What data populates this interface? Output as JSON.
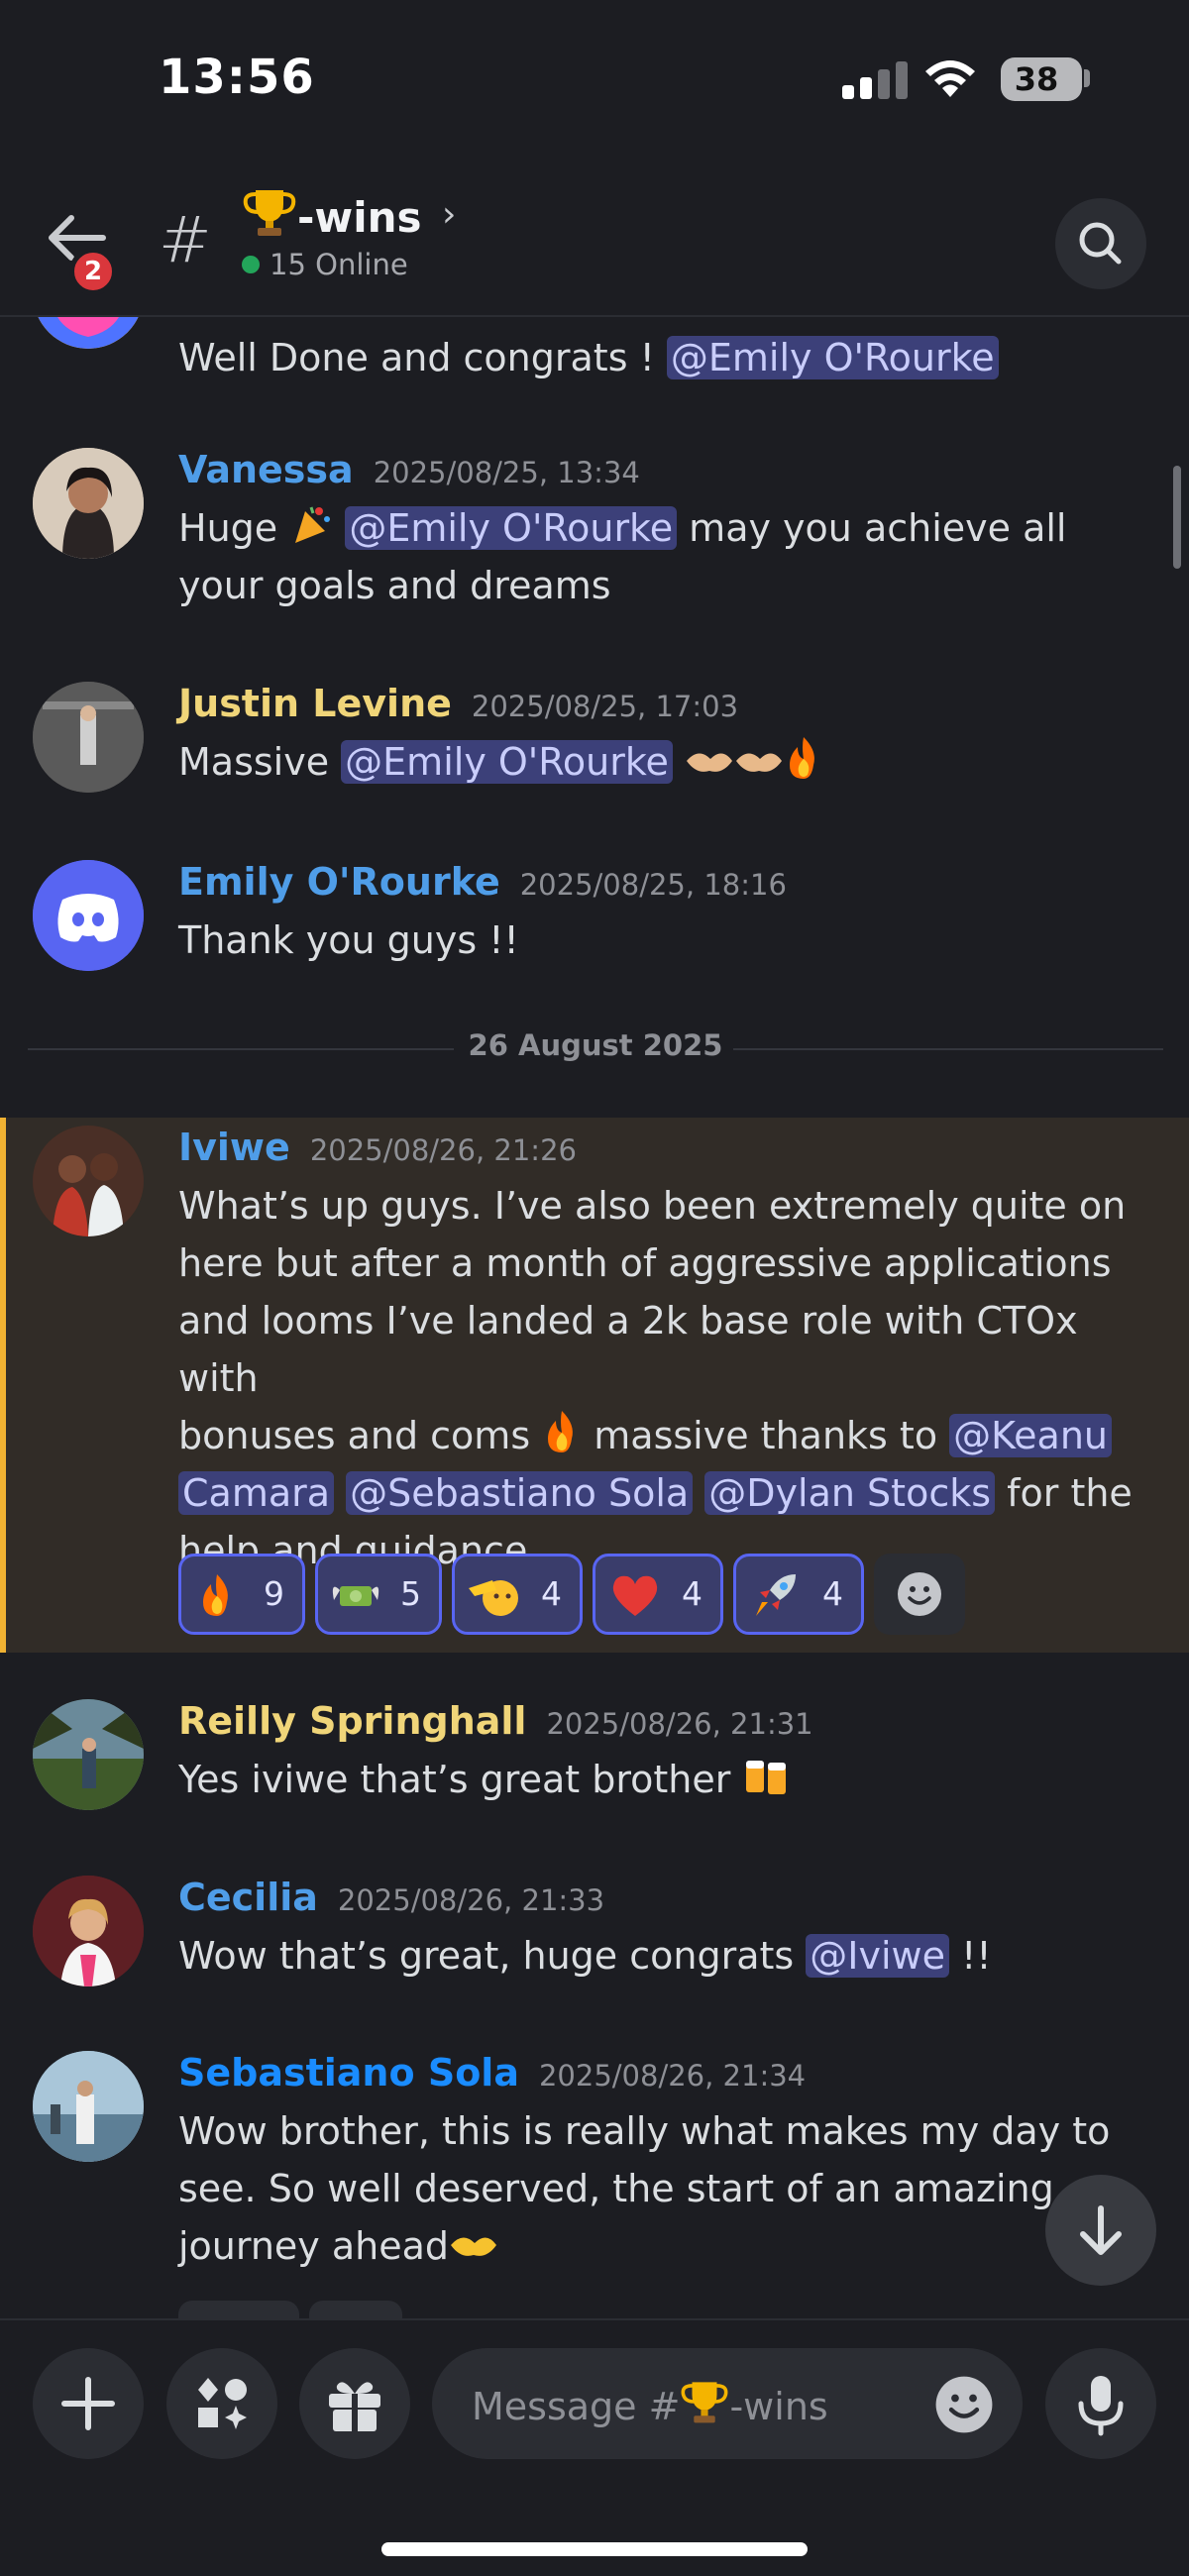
{
  "status_bar": {
    "time": "13:56",
    "battery": "38"
  },
  "header": {
    "back_badge": "2",
    "channel_name": "-wins",
    "channel_emoji": "trophy-icon",
    "online": "15 Online"
  },
  "feed": {
    "partial_message": {
      "text": "Well Done and congrats ! ",
      "mention": "@Emily O'Rourke"
    },
    "messages": [
      {
        "author": "Vanessa",
        "time": "2025/08/25, 13:34",
        "text_a": "Huge ",
        "mention": "@Emily O'Rourke",
        "text_b": " may you achieve all your goals and dreams",
        "author_color": "#4f9de8"
      },
      {
        "author": "Justin Levine",
        "time": "2025/08/25, 17:03",
        "text_a": "Massive ",
        "mention": "@Emily O'Rourke",
        "author_color": "#f0d579"
      },
      {
        "author": "Emily O'Rourke",
        "time": "2025/08/25, 18:16",
        "text_a": "Thank you guys !!",
        "author_color": "#4f9de8"
      }
    ],
    "date_divider": "26 August 2025",
    "highlighted": {
      "author": "Iviwe",
      "time": "2025/08/26, 21:26",
      "line1": "What’s up guys. I’ve also been extremely quite on",
      "line2": "here but after a month of aggressive applications",
      "line3": "and looms I’ve landed a 2k base role with CTOx with",
      "line4_a": "bonuses and coms ",
      "line4_b": " massive thanks to ",
      "mention_1a": "@Keanu",
      "mention_1b": "Camara",
      "mention_2": "@Sebastiano Sola",
      "mention_3": "@Dylan Stocks",
      "line5_b": " for the",
      "line6": "help and guidance",
      "reactions": [
        {
          "emoji": "fire-emoji",
          "count": "9"
        },
        {
          "emoji": "money-wings-emoji",
          "count": "5"
        },
        {
          "emoji": "salute-emoji",
          "count": "4"
        },
        {
          "emoji": "red-heart-emoji",
          "count": "4"
        },
        {
          "emoji": "rocket-emoji",
          "count": "4"
        }
      ]
    },
    "more_messages": [
      {
        "author": "Reilly Springhall",
        "time": "2025/08/26, 21:31",
        "text": "Yes iviwe that’s great brother ",
        "author_color": "#f0d579"
      },
      {
        "author": "Cecilia",
        "time": "2025/08/26, 21:33",
        "text_a": "Wow that’s great, huge congrats ",
        "mention": "@Iviwe",
        "text_b": " !!",
        "author_color": "#4f9de8"
      },
      {
        "author": "Sebastiano Sola",
        "time": "2025/08/26, 21:34",
        "line1": "Wow brother, this is really what makes my day to",
        "line2": "see. So well deserved, the start of an amazing",
        "line3": "journey ahead",
        "author_color": "#1a8cff"
      }
    ]
  },
  "composer": {
    "placeholder_prefix": "Message #",
    "placeholder_suffix": "-wins"
  },
  "colors": {
    "accent": "#5865f2",
    "highlight_bar": "#f0b232",
    "online": "#23a55a",
    "badge": "#da373c"
  }
}
